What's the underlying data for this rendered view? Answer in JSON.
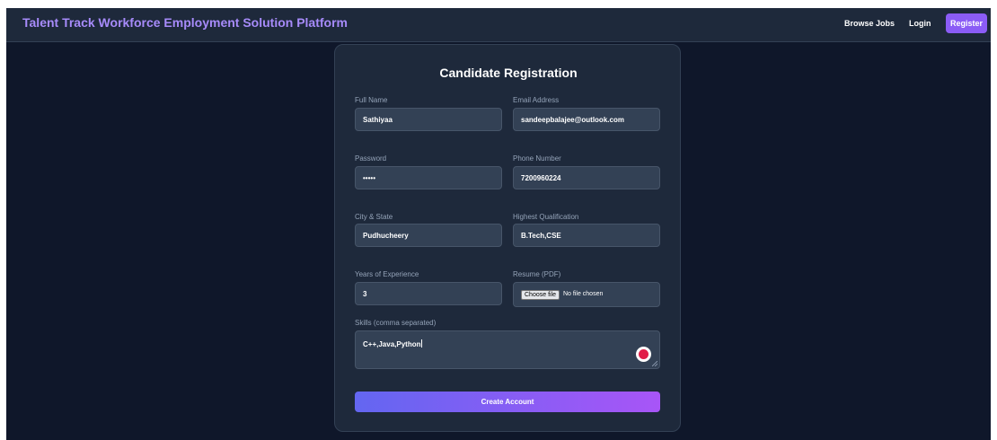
{
  "header": {
    "brand": "Talent Track Workforce Employment Solution Platform",
    "nav": {
      "browse_jobs": "Browse Jobs",
      "login": "Login",
      "register": "Register"
    }
  },
  "form": {
    "title": "Candidate Registration",
    "fields": {
      "full_name": {
        "label": "Full Name",
        "value": "Sathiyaa"
      },
      "email": {
        "label": "Email Address",
        "value": "sandeepbalajee@outlook.com"
      },
      "password": {
        "label": "Password",
        "value": "•••••"
      },
      "phone": {
        "label": "Phone Number",
        "value": "7200960224"
      },
      "city_state": {
        "label": "City & State",
        "value": "Pudhucheery"
      },
      "qualification": {
        "label": "Highest Qualification",
        "value": "B.Tech,CSE"
      },
      "experience": {
        "label": "Years of Experience",
        "value": "3"
      },
      "resume": {
        "label": "Resume (PDF)",
        "button": "Choose file",
        "status": "No file chosen"
      },
      "skills": {
        "label": "Skills (comma separated)",
        "value": "C++,Java,Python"
      }
    },
    "submit_label": "Create Account"
  },
  "colors": {
    "background": "#0f172a",
    "navbar": "#1e293b",
    "brand": "#a78bfa",
    "accent": "#8b5cf6",
    "card": "#1e293b",
    "input": "#334155",
    "button_gradient_start": "#6366f1",
    "button_gradient_end": "#a855f7",
    "assist_icon": "#e11d48"
  },
  "icons": {
    "textarea_assist": "grammar-assistant-icon",
    "resize": "resize-grip-icon"
  }
}
